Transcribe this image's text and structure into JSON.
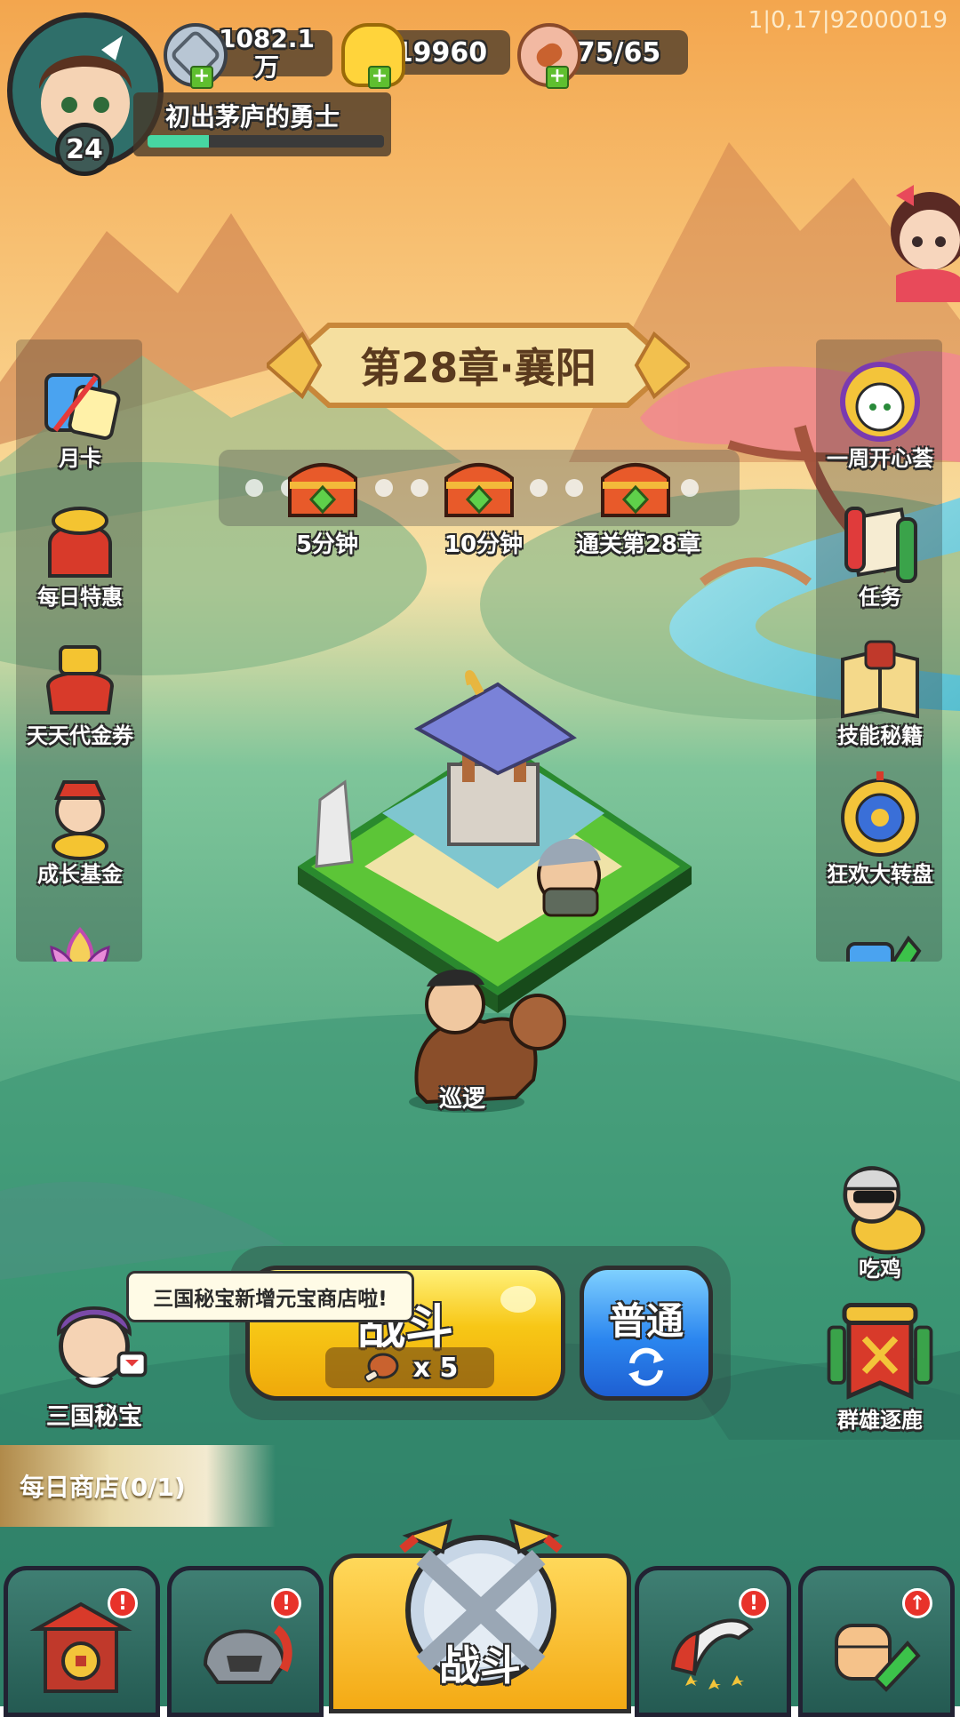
{
  "debug": {
    "build_id": "1|0,17|92000019"
  },
  "player": {
    "level": "24",
    "title": "初出茅庐的勇士",
    "xp_progress": 0.26
  },
  "resources": {
    "silver": "1082.1\n万",
    "gold": "19960",
    "stamina": "75/65"
  },
  "chapter": {
    "title": "第28章·襄阳",
    "rewards": [
      {
        "label": "5分钟"
      },
      {
        "label": "10分钟"
      },
      {
        "label": "通关第28章"
      }
    ]
  },
  "left_menu": [
    {
      "label": "月卡",
      "icon": "calendar-card-icon"
    },
    {
      "label": "每日特惠",
      "icon": "gift-bag-icon"
    },
    {
      "label": "天天代金券",
      "icon": "gold-ingot-bag-icon"
    },
    {
      "label": "成长基金",
      "icon": "fortune-god-icon"
    },
    {
      "label": "",
      "icon": "lotus-icon"
    }
  ],
  "right_menu": [
    {
      "label": "一周开心荟",
      "icon": "happy-week-icon"
    },
    {
      "label": "任务",
      "icon": "scroll-icon"
    },
    {
      "label": "技能秘籍",
      "icon": "skill-book-icon"
    },
    {
      "label": "狂欢大转盘",
      "icon": "wheel-icon"
    },
    {
      "label": "",
      "icon": "upgrade-arrow-icon"
    }
  ],
  "map": {
    "patrol_label": "巡逻"
  },
  "side_features": {
    "chicken": "吃鸡",
    "qunxiong": "群雄逐鹿",
    "treasure": "三国秘宝",
    "treasure_bubble": "三国秘宝新增元宝商店啦!",
    "daily_shop": "每日商店(0/1)"
  },
  "battle": {
    "label": "战斗",
    "cost": "x 5",
    "mode_label": "普通"
  },
  "bottom_nav": [
    {
      "label": "",
      "icon": "shop-gate-icon",
      "alert": "!"
    },
    {
      "label": "",
      "icon": "helmet-icon",
      "alert": "!"
    },
    {
      "label": "战斗",
      "icon": "crossed-swords-icon",
      "alert": ""
    },
    {
      "label": "",
      "icon": "hero-horn-icon",
      "alert": "!"
    },
    {
      "label": "",
      "icon": "fist-upgrade-icon",
      "alert": "↑"
    }
  ],
  "colors": {
    "sky_top": "#f7b45a",
    "sky_mid": "#f9cf86",
    "grass": "#3f9a74",
    "battle_yellow": "#f7c716",
    "mode_blue": "#2b86ef",
    "nav_teal": "#2f6f64",
    "alert_red": "#e8322a"
  }
}
